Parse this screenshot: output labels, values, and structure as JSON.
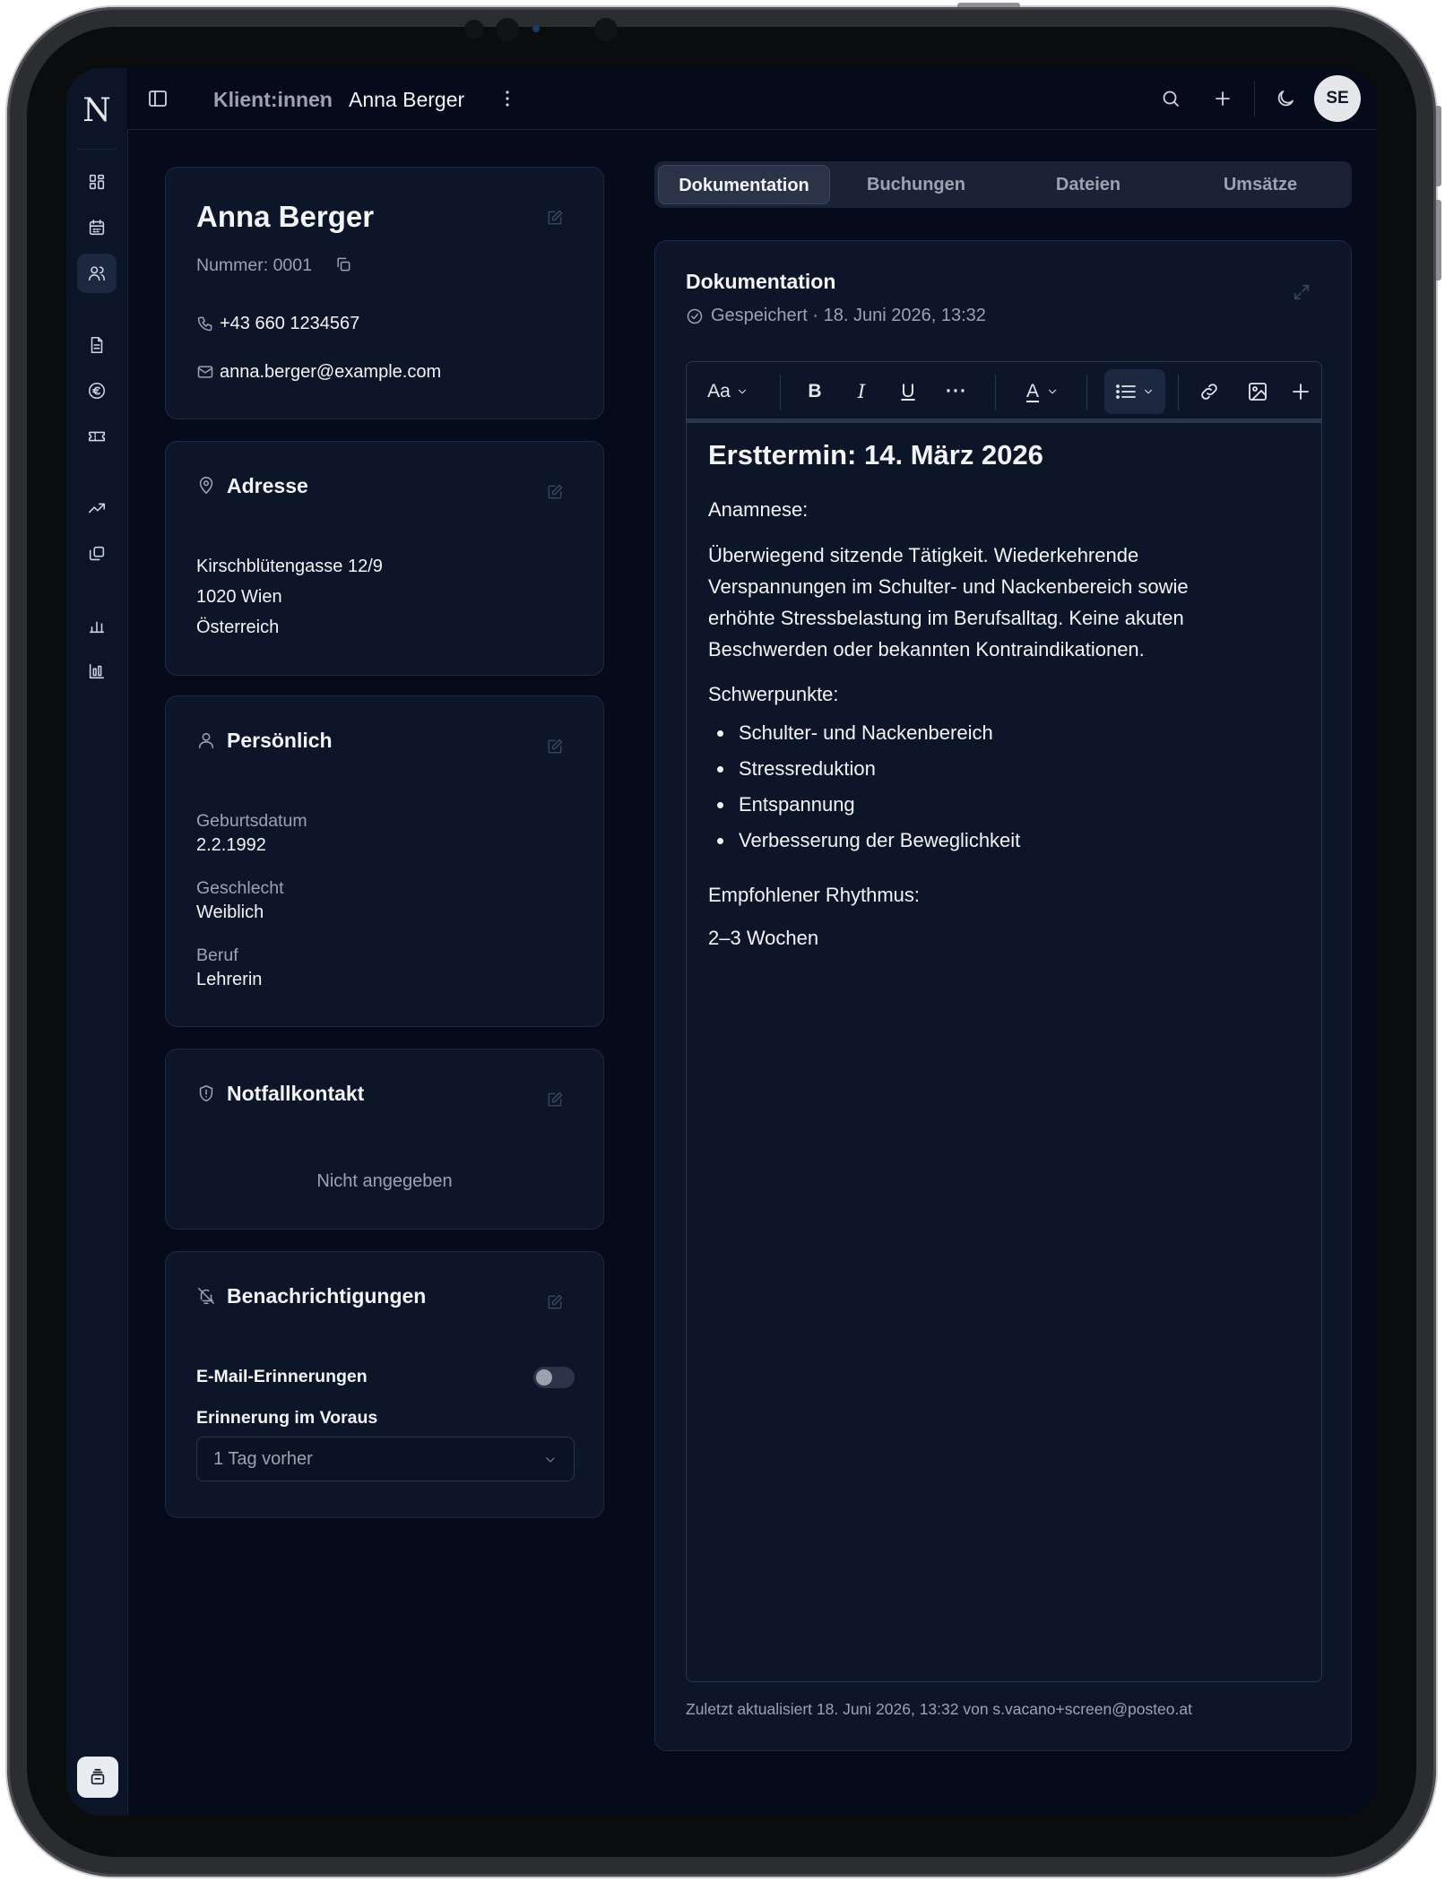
{
  "breadcrumb": {
    "parent": "Klient:innen",
    "separator": "›",
    "current": "Anna Berger"
  },
  "user": {
    "initials": "SE"
  },
  "rail": {
    "logo": "N"
  },
  "client": {
    "name": "Anna Berger",
    "number": "Nummer: 0001",
    "phone": "+43 660 1234567",
    "email": "anna.berger@example.com"
  },
  "address": {
    "title": "Adresse",
    "line1": "Kirschblütengasse 12/9",
    "line2": "1020 Wien",
    "line3": "Österreich"
  },
  "personal": {
    "title": "Persönlich",
    "fields": [
      {
        "label": "Geburtsdatum",
        "value": "2.2.1992"
      },
      {
        "label": "Geschlecht",
        "value": "Weiblich"
      },
      {
        "label": "Beruf",
        "value": "Lehrerin"
      }
    ]
  },
  "emergency": {
    "title": "Notfallkontakt",
    "empty": "Nicht angegeben"
  },
  "notifications": {
    "title": "Benachrichtigungen",
    "email_reminders_label": "E-Mail-Erinnerungen",
    "email_reminders_on": false,
    "advance_label": "Erinnerung im Voraus",
    "advance_value": "1 Tag vorher"
  },
  "tabs": [
    {
      "label": "Dokumentation",
      "active": true
    },
    {
      "label": "Buchungen",
      "active": false
    },
    {
      "label": "Dateien",
      "active": false
    },
    {
      "label": "Umsätze",
      "active": false
    }
  ],
  "doc": {
    "title": "Dokumentation",
    "status": "Gespeichert · 18. Juni 2026, 13:32",
    "toolbar": {
      "font": "Aa",
      "bold": "B",
      "italic": "I",
      "underline": "U",
      "more": "···",
      "text_color": "A"
    },
    "heading": "Ersttermin: 14. März 2026",
    "anamnese_label": "Anamnese:",
    "anamnese_text": "Überwiegend sitzende Tätigkeit. Wiederkehrende Verspannungen im Schulter- und Nackenbereich sowie erhöhte Stressbelastung im Berufsalltag. Keine akuten Beschwerden oder bekannten Kontraindikationen.",
    "focus_label": "Schwerpunkte:",
    "focus_items": [
      "Schulter- und Nackenbereich",
      "Stressreduktion",
      "Entspannung",
      "Verbesserung der Beweglichkeit"
    ],
    "rhythm_label": "Empfohlener Rhythmus:",
    "rhythm_value": "2–3 Wochen",
    "footer": "Zuletzt aktualisiert 18. Juni 2026, 13:32 von s.vacano+screen@posteo.at"
  }
}
